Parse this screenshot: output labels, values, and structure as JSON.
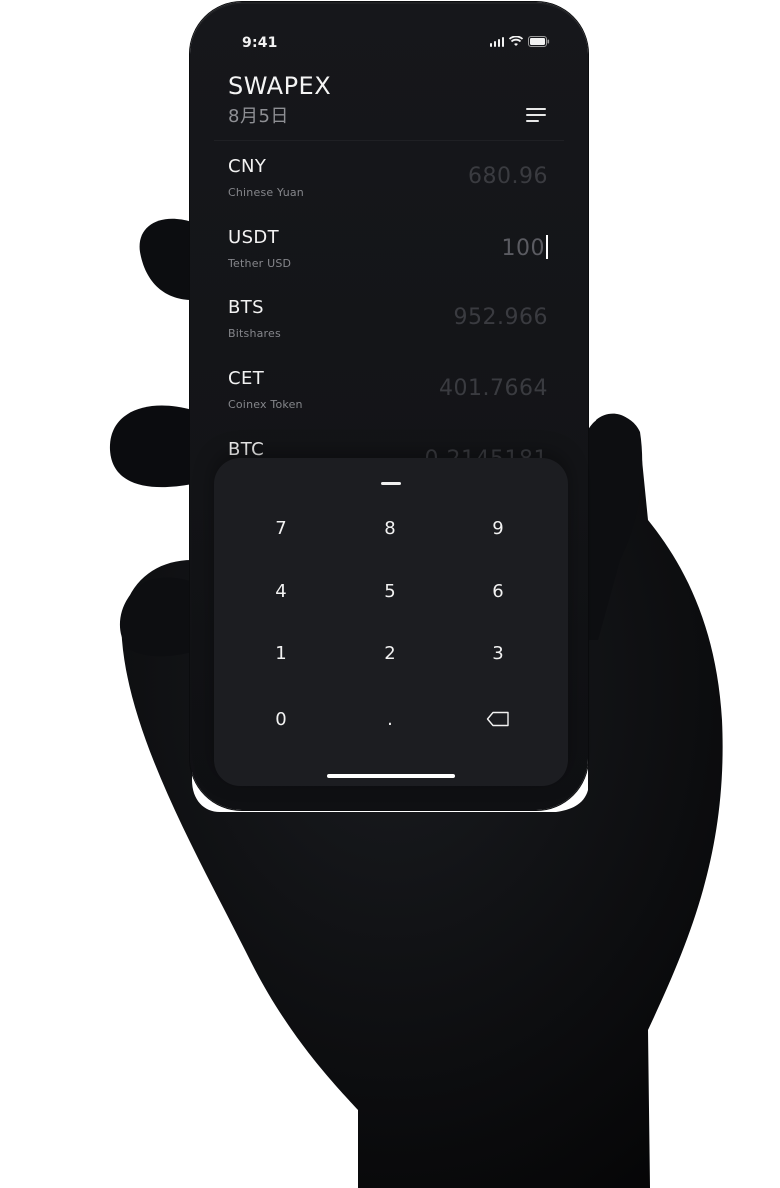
{
  "status_bar": {
    "time": "9:41"
  },
  "header": {
    "title": "SWAPEX",
    "date": "8月5日"
  },
  "rates": [
    {
      "code": "CNY",
      "name": "Chinese Yuan",
      "value": "680.96"
    },
    {
      "code": "USDT",
      "name": "Tether USD",
      "value": "100"
    },
    {
      "code": "BTS",
      "name": "Bitshares",
      "value": "952.966"
    },
    {
      "code": "CET",
      "name": "Coinex Token",
      "value": "401.7664"
    },
    {
      "code": "BTC",
      "name": "",
      "value": "0.2145181"
    }
  ],
  "keypad": {
    "keys": [
      "7",
      "8",
      "9",
      "4",
      "5",
      "6",
      "1",
      "2",
      "3",
      "0",
      "."
    ],
    "backspace_icon": "backspace-icon"
  },
  "colors": {
    "phone_bg": "#131417",
    "keypad_bg": "#1c1d21",
    "text_primary": "#f2f2f2",
    "text_muted": "#85868b",
    "value_dim": "#3a3b40"
  }
}
